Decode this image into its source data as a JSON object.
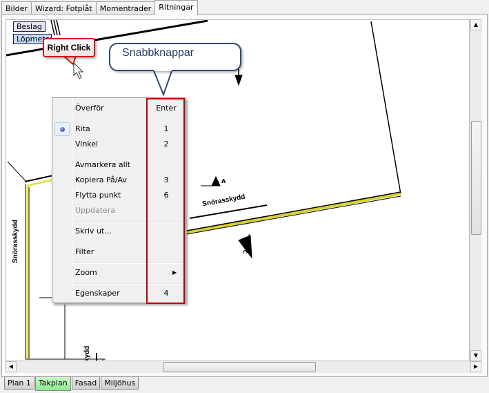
{
  "top_tabs": [
    {
      "label": "Bilder",
      "active": false
    },
    {
      "label": "Wizard: Fotplåt",
      "active": false
    },
    {
      "label": "Momentrader",
      "active": false
    },
    {
      "label": "Ritningar",
      "active": true
    }
  ],
  "drawing": {
    "buttons": {
      "beslag": "Beslag",
      "lopmeter": "Löpmeter"
    },
    "labels": {
      "snorasskydd_left": "Snörasskydd",
      "snorasskydd_right": "Snörasskydd",
      "snorasskydd_bottom": "kydd",
      "marker_a": "A",
      "marker_c": "C"
    },
    "highlight_color": "#f5f06a"
  },
  "callouts": {
    "right_click": "Right Click",
    "shortcuts": "Snabbknappar"
  },
  "context_menu": {
    "items": [
      {
        "label": "Överför",
        "shortcut": "Enter"
      },
      {
        "label": "Rita",
        "shortcut": "1",
        "checked": true
      },
      {
        "label": "Vinkel",
        "shortcut": "2"
      },
      {
        "label": "Avmarkera allt",
        "shortcut": ""
      },
      {
        "label": "Kopiera På/Av",
        "shortcut": "3"
      },
      {
        "label": "Flytta punkt",
        "shortcut": "6"
      },
      {
        "label": "Uppdatera",
        "shortcut": "",
        "disabled": true
      },
      {
        "label": "Skriv ut...",
        "shortcut": ""
      },
      {
        "label": "Filter",
        "shortcut": ""
      },
      {
        "label": "Zoom",
        "shortcut": "",
        "submenu": true
      },
      {
        "label": "Egenskaper",
        "shortcut": "4"
      }
    ]
  },
  "scrollbars": {
    "vertical_position": 0.3,
    "horizontal_position": 0.4
  },
  "bottom_tabs": [
    {
      "label": "Plan 1",
      "active": false
    },
    {
      "label": "Takplan",
      "active": true
    },
    {
      "label": "Fasad",
      "active": false
    },
    {
      "label": "Miljöhus",
      "active": false
    }
  ]
}
